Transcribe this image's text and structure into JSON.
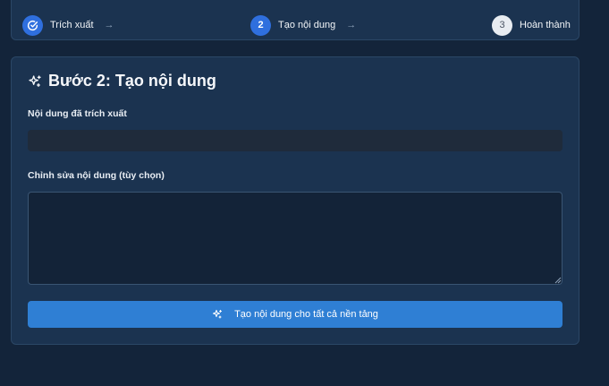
{
  "stepper": {
    "steps": [
      {
        "number": "",
        "label": "Trích xuất",
        "state": "done",
        "icon": "check-circle-icon"
      },
      {
        "number": "2",
        "label": "Tạo nội dung",
        "state": "active"
      },
      {
        "number": "3",
        "label": "Hoàn thành",
        "state": "pending"
      }
    ],
    "arrow": "→"
  },
  "card": {
    "title": "Bước 2: Tạo nội dung",
    "title_icon": "sparkles-icon",
    "extracted_label": "Nội dung đã trích xuất",
    "extracted_value": "",
    "edit_label": "Chỉnh sửa nội dung (tùy chọn)",
    "edit_value": "",
    "generate_button": "Tạo nội dung cho tất cả nền tảng",
    "generate_icon": "sparkles-icon"
  },
  "colors": {
    "background": "#13243a",
    "card": "#1b3350",
    "accent": "#2f6fde",
    "button": "#2f7fd4"
  }
}
